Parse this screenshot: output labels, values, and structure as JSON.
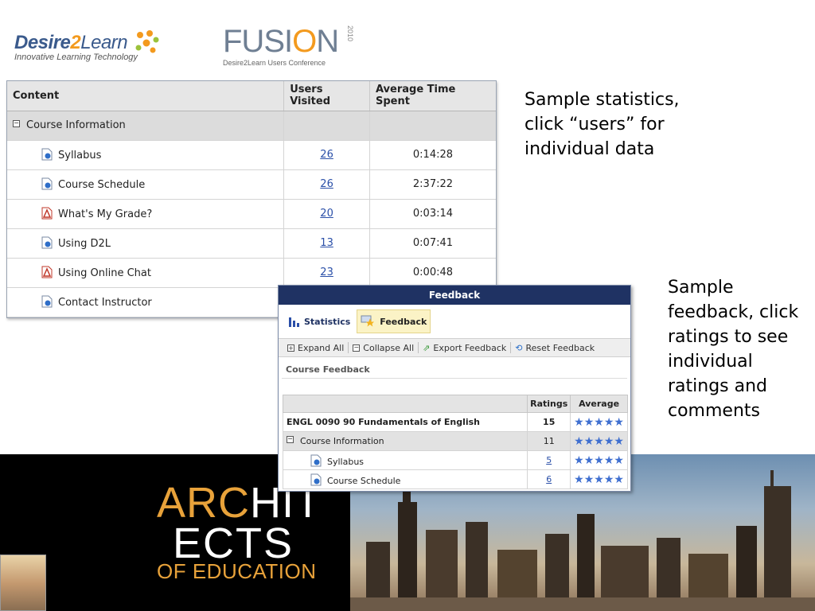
{
  "logos": {
    "d2l_word_1": "Desire",
    "d2l_word_2": "2",
    "d2l_word_3": "Learn",
    "d2l_tagline": "Innovative Learning Technology",
    "fusion_word_1": "FUS",
    "fusion_word_2": "I",
    "fusion_word_3": "O",
    "fusion_word_4": "N",
    "fusion_sub": "Desire2Learn Users Conference",
    "fusion_year": "2010"
  },
  "stats": {
    "headers": [
      "Content",
      "Users Visited",
      "Average Time Spent"
    ],
    "group_label": "Course Information",
    "rows": [
      {
        "title": "Syllabus",
        "users": "26",
        "time": "0:14:28",
        "icon": "doc-icon"
      },
      {
        "title": "Course Schedule",
        "users": "26",
        "time": "2:37:22",
        "icon": "doc-icon"
      },
      {
        "title": "What's My Grade?",
        "users": "20",
        "time": "0:03:14",
        "icon": "pdf-icon"
      },
      {
        "title": "Using D2L",
        "users": "13",
        "time": "0:07:41",
        "icon": "doc-icon"
      },
      {
        "title": "Using Online Chat",
        "users": "23",
        "time": "0:00:48",
        "icon": "pdf-icon"
      },
      {
        "title": "Contact Instructor",
        "users": "",
        "time": "",
        "icon": "doc-icon"
      }
    ]
  },
  "captions": {
    "stats_note": "Sample statistics, click “users” for individual data",
    "feedback_note": "Sample feedback, click ratings to see individual ratings and comments"
  },
  "feedback": {
    "title": "Feedback",
    "tab_statistics": "Statistics",
    "tab_feedback": "Feedback",
    "tools": [
      "Expand All",
      "Collapse All",
      "Export Feedback",
      "Reset Feedback"
    ],
    "section_title": "Course Feedback",
    "headers": [
      "",
      "Ratings",
      "Average"
    ],
    "rows": [
      {
        "title": "ENGL 0090 90 Fundamentals of English",
        "ratings": "15",
        "average": 5
      },
      {
        "title": "Course Information",
        "ratings": "11",
        "average": 5
      },
      {
        "title": "Syllabus",
        "ratings": "5",
        "average": 5
      },
      {
        "title": "Course Schedule",
        "ratings": "6",
        "average": 5
      }
    ]
  },
  "banner": {
    "line1a": "ARC",
    "line1b": "H",
    "line1c": "IT",
    "line2": "ECTS",
    "line3": "OF EDUCATION"
  },
  "colors": {
    "titlebar": "#1f3263",
    "link": "#2a4fa8",
    "accent_orange": "#f39a1e",
    "star_blue": "#3f6fd0"
  }
}
